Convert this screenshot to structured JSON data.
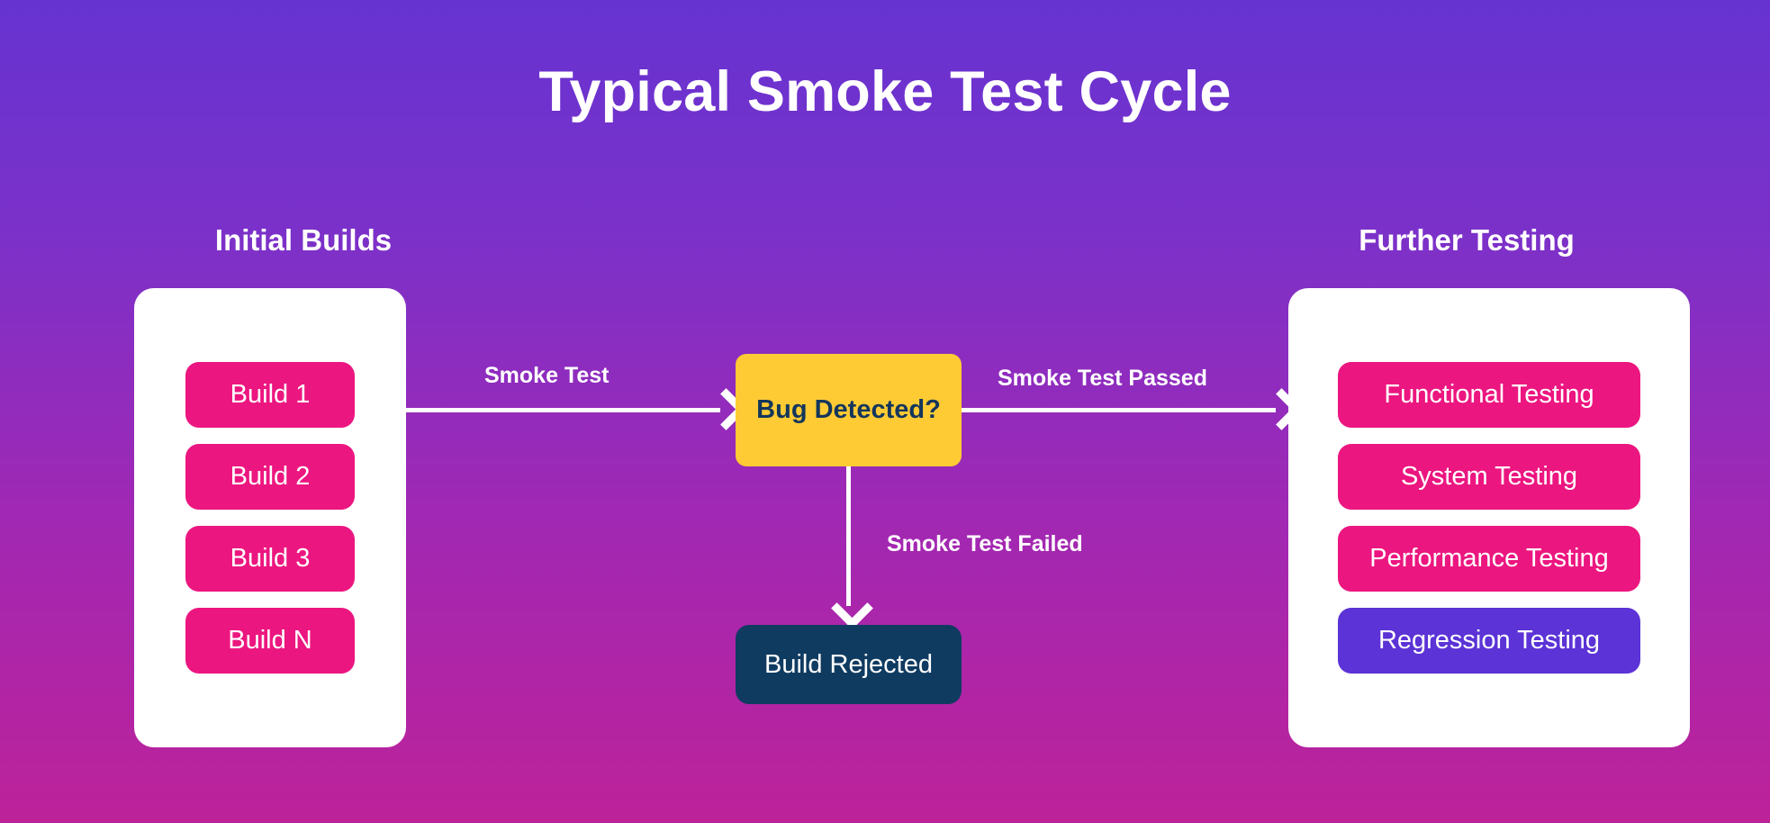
{
  "diagram": {
    "title": "Typical Smoke Test Cycle",
    "background": {
      "gradient_from": "#6633D1",
      "gradient_to": "#BD2299"
    }
  },
  "left_column": {
    "heading": "Initial Builds",
    "panel_color": "#FFFFFF",
    "items": [
      {
        "label": "Build 1",
        "color": "#EC1680"
      },
      {
        "label": "Build 2",
        "color": "#EC1680"
      },
      {
        "label": "Build 3",
        "color": "#EC1680"
      },
      {
        "label": "Build N",
        "color": "#EC1680"
      }
    ]
  },
  "right_column": {
    "heading": "Further Testing",
    "panel_color": "#FFFFFF",
    "items": [
      {
        "label": "Functional Testing",
        "color": "#EC1680"
      },
      {
        "label": "System Testing",
        "color": "#EC1680"
      },
      {
        "label": "Performance Testing",
        "color": "#EC1680"
      },
      {
        "label": "Regression Testing",
        "color": "#5B33D6"
      }
    ]
  },
  "decision": {
    "label": "Bug Detected?",
    "fill": "#FFCB34",
    "text_color": "#14365C"
  },
  "rejected": {
    "label": "Build Rejected",
    "fill": "#0F3B61",
    "text_color": "#FFFFFF"
  },
  "edges": {
    "to_decision": "Smoke Test",
    "passed": "Smoke Test Passed",
    "failed": "Smoke Test Failed"
  }
}
